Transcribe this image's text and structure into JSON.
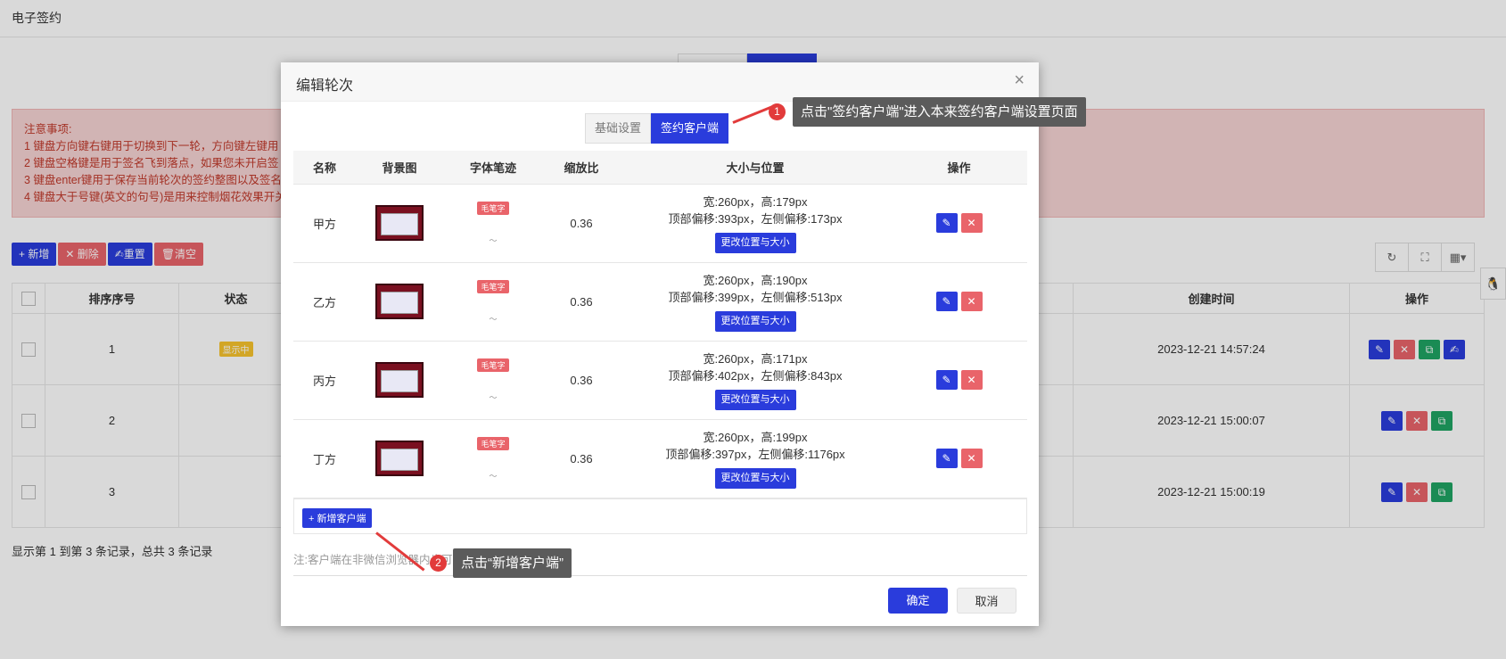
{
  "topbar": {
    "title": "电子签约"
  },
  "notice": {
    "lines": [
      "注意事项:",
      "1 键盘方向键右键用于切换到下一轮，方向键左键用",
      "2 键盘空格键是用于签名飞到落点，如果您未开启签",
      "3 键盘enter键用于保存当前轮次的签约整图以及签名",
      "4 键盘大于号键(英文的句号)是用来控制烟花效果开关"
    ]
  },
  "toolbar": {
    "add": "+ 新增",
    "delete": "✕ 删除",
    "reset": "重置",
    "clear": "清空"
  },
  "bg_table": {
    "headers": [
      "排序序号",
      "状态",
      "创建时间",
      "操作"
    ],
    "rows": [
      {
        "order": "1",
        "status": "显示中",
        "created": "2023-12-21 14:57:24"
      },
      {
        "order": "2",
        "status": "",
        "created": "2023-12-21 15:00:07"
      },
      {
        "order": "3",
        "status": "",
        "created": "2023-12-21 15:00:19"
      }
    ]
  },
  "pagination": {
    "info": "显示第 1 到第 3 条记录，总共 3 条记录"
  },
  "dialog": {
    "title": "编辑轮次",
    "tabs": [
      "基础设置",
      "签约客户端"
    ],
    "columns": [
      "名称",
      "背景图",
      "字体笔迹",
      "缩放比",
      "大小与位置",
      "操作"
    ],
    "rows": [
      {
        "name": "甲方",
        "font": "毛笔字",
        "scale": "0.36",
        "size": "宽:260px，高:179px",
        "offset": "顶部偏移:393px，左侧偏移:173px",
        "change": "更改位置与大小"
      },
      {
        "name": "乙方",
        "font": "毛笔字",
        "scale": "0.36",
        "size": "宽:260px，高:190px",
        "offset": "顶部偏移:399px，左侧偏移:513px",
        "change": "更改位置与大小"
      },
      {
        "name": "丙方",
        "font": "毛笔字",
        "scale": "0.36",
        "size": "宽:260px，高:171px",
        "offset": "顶部偏移:402px，左侧偏移:843px",
        "change": "更改位置与大小"
      },
      {
        "name": "丁方",
        "font": "毛笔字",
        "scale": "0.36",
        "size": "宽:260px，高:199px",
        "offset": "顶部偏移:397px，左侧偏移:1176px",
        "change": "更改位置与大小"
      }
    ],
    "add_client": "+ 新增客户端",
    "note": "注:客户端在非微信浏览器内也可以打开",
    "ok": "确定",
    "cancel": "取消"
  },
  "callouts": {
    "c1_num": "1",
    "c1_text": "点击\"签约客户端\"进入本来签约客户端设置页面",
    "c2_num": "2",
    "c2_text": "点击“新增客户端”"
  },
  "colors": {
    "primary": "#2a3cdc",
    "danger": "#e9646a",
    "success": "#1fa463",
    "callout": "#5b5b5b",
    "marker": "#e23b3b"
  }
}
